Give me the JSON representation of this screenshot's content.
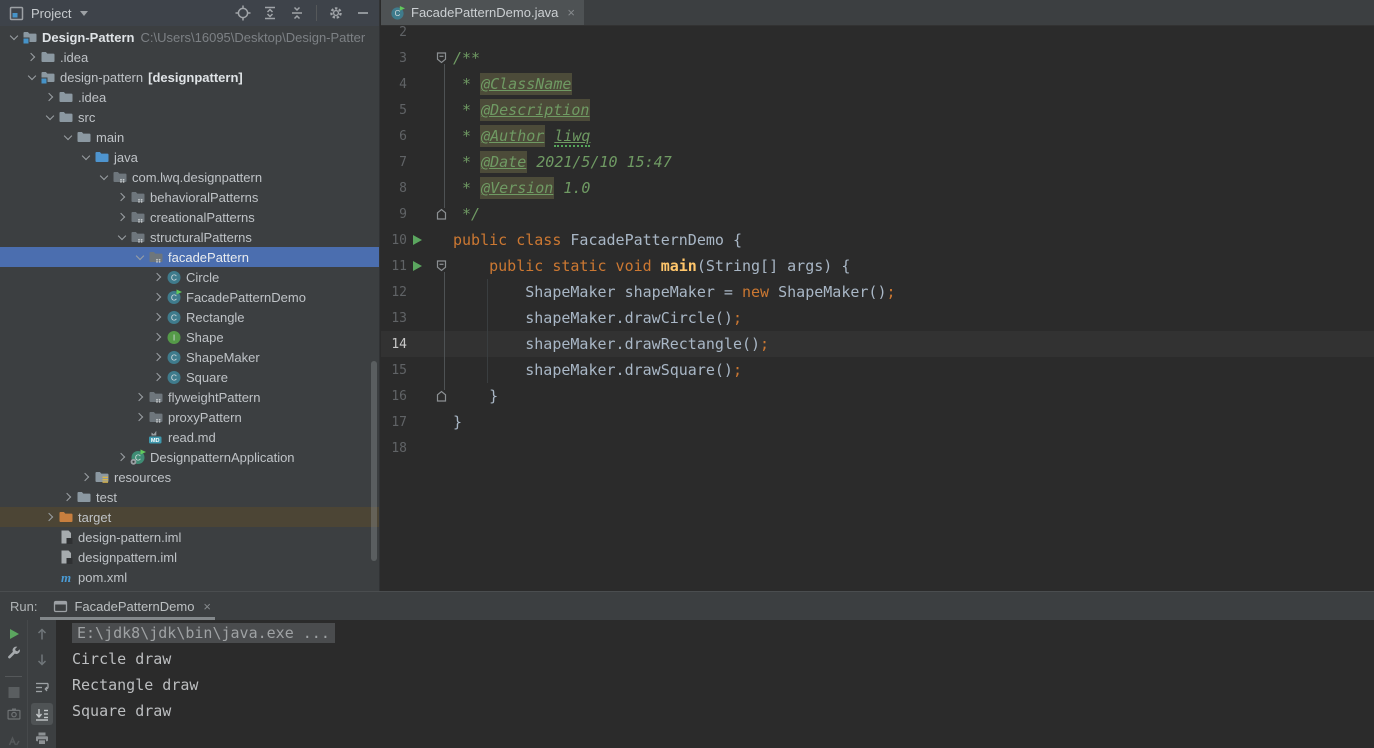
{
  "colors": {
    "selection_blue": "#4b6eaf",
    "excluded_row_bg": "#4c4535",
    "panel_bg": "#3c3f41",
    "editor_bg": "#2b2b2b",
    "current_line_bg": "#323232",
    "keyword_orange": "#cc7832",
    "plain_text": "#a9b7c6",
    "method_yellow": "#ffc66b",
    "comment_green": "#6f9a63",
    "doc_tag_bg": "#4c4b39",
    "run_green": "#5ba65f"
  },
  "project_panel": {
    "title": "Project",
    "header_icons": [
      "project-window-icon",
      "locate-icon",
      "expand-all-icon",
      "collapse-all-icon",
      "settings-gear-icon",
      "hide-panel-icon"
    ],
    "tree": [
      {
        "label": "Design-Pattern",
        "bold": true,
        "suffix": "C:\\Users\\16095\\Desktop\\Design-Patter",
        "level": 0,
        "chevron": "expanded",
        "icon": "module-folder"
      },
      {
        "label": ".idea",
        "level": 1,
        "chevron": "collapsed",
        "icon": "folder"
      },
      {
        "label": "design-pattern",
        "suffix_bold": "[designpattern]",
        "level": 1,
        "chevron": "expanded",
        "icon": "module-folder"
      },
      {
        "label": ".idea",
        "level": 2,
        "chevron": "collapsed",
        "icon": "folder"
      },
      {
        "label": "src",
        "level": 2,
        "chevron": "expanded",
        "icon": "folder"
      },
      {
        "label": "main",
        "level": 3,
        "chevron": "expanded",
        "icon": "folder"
      },
      {
        "label": "java",
        "level": 4,
        "chevron": "expanded",
        "icon": "source-folder"
      },
      {
        "label": "com.lwq.designpattern",
        "level": 5,
        "chevron": "expanded",
        "icon": "package"
      },
      {
        "label": "behavioralPatterns",
        "level": 6,
        "chevron": "collapsed",
        "icon": "package"
      },
      {
        "label": "creationalPatterns",
        "level": 6,
        "chevron": "collapsed",
        "icon": "package"
      },
      {
        "label": "structuralPatterns",
        "level": 6,
        "chevron": "expanded",
        "icon": "package"
      },
      {
        "label": "facadePattern",
        "level": 7,
        "chevron": "expanded",
        "icon": "package",
        "state": "selected"
      },
      {
        "label": "Circle",
        "level": 8,
        "chevron": "collapsed",
        "icon": "class"
      },
      {
        "label": "FacadePatternDemo",
        "level": 8,
        "chevron": "collapsed",
        "icon": "class-run"
      },
      {
        "label": "Rectangle",
        "level": 8,
        "chevron": "collapsed",
        "icon": "class"
      },
      {
        "label": "Shape",
        "level": 8,
        "chevron": "collapsed",
        "icon": "interface"
      },
      {
        "label": "ShapeMaker",
        "level": 8,
        "chevron": "collapsed",
        "icon": "class"
      },
      {
        "label": "Square",
        "level": 8,
        "chevron": "collapsed",
        "icon": "class"
      },
      {
        "label": "flyweightPattern",
        "level": 7,
        "chevron": "collapsed",
        "icon": "package"
      },
      {
        "label": "proxyPattern",
        "level": 7,
        "chevron": "collapsed",
        "icon": "package"
      },
      {
        "label": "read.md",
        "level": 7,
        "chevron": "none",
        "icon": "markdown"
      },
      {
        "label": "DesignpatternApplication",
        "level": 6,
        "chevron": "collapsed",
        "icon": "class-run-config"
      },
      {
        "label": "resources",
        "level": 4,
        "chevron": "collapsed",
        "icon": "resources-folder"
      },
      {
        "label": "test",
        "level": 3,
        "chevron": "collapsed",
        "icon": "folder"
      },
      {
        "label": "target",
        "level": 2,
        "chevron": "collapsed",
        "icon": "excluded-folder",
        "state": "excluded"
      },
      {
        "label": "design-pattern.iml",
        "level": 2,
        "chevron": "none",
        "icon": "iml-file"
      },
      {
        "label": "designpattern.iml",
        "level": 2,
        "chevron": "none",
        "icon": "iml-file"
      },
      {
        "label": "pom.xml",
        "level": 2,
        "chevron": "none",
        "icon": "maven-file"
      }
    ]
  },
  "editor": {
    "tab": {
      "label": "FacadePatternDemo.java",
      "icon": "class-run",
      "close": "×"
    },
    "lines": [
      {
        "num": 2,
        "tokens": []
      },
      {
        "num": 3,
        "fold": "start",
        "tokens": [
          [
            "/**",
            "cm"
          ]
        ]
      },
      {
        "num": 4,
        "tokens": [
          [
            " * ",
            "cm"
          ],
          [
            "@ClassName",
            "tag"
          ]
        ]
      },
      {
        "num": 5,
        "tokens": [
          [
            " * ",
            "cm"
          ],
          [
            "@Description",
            "tag"
          ]
        ]
      },
      {
        "num": 6,
        "tokens": [
          [
            " * ",
            "cm"
          ],
          [
            "@Author",
            "tag"
          ],
          [
            " ",
            "cm"
          ],
          [
            "liwq",
            "typo"
          ]
        ]
      },
      {
        "num": 7,
        "tokens": [
          [
            " * ",
            "cm"
          ],
          [
            "@Date",
            "tag"
          ],
          [
            " 2021/5/10 15:47",
            "cm"
          ]
        ]
      },
      {
        "num": 8,
        "tokens": [
          [
            " * ",
            "cm"
          ],
          [
            "@Version",
            "tag"
          ],
          [
            " 1.0",
            "cm"
          ]
        ]
      },
      {
        "num": 9,
        "fold": "end",
        "tokens": [
          [
            " */",
            "cm"
          ]
        ]
      },
      {
        "num": 10,
        "run": true,
        "tokens": [
          [
            "public class ",
            "kw"
          ],
          [
            "FacadePatternDemo {",
            "pl"
          ]
        ]
      },
      {
        "num": 11,
        "run": true,
        "fold": "start",
        "tokens": [
          [
            "    ",
            "pl"
          ],
          [
            "public static void ",
            "kw"
          ],
          [
            "main",
            "mn"
          ],
          [
            "(String[] args) {",
            "pl"
          ]
        ]
      },
      {
        "num": 12,
        "tokens": [
          [
            "        ShapeMaker shapeMaker = ",
            "pl"
          ],
          [
            "new",
            "kw"
          ],
          [
            " ShapeMaker()",
            "pl"
          ],
          [
            ";",
            "kw"
          ]
        ]
      },
      {
        "num": 13,
        "tokens": [
          [
            "        shapeMaker.drawCircle()",
            "pl"
          ],
          [
            ";",
            "kw"
          ]
        ]
      },
      {
        "num": 14,
        "current": true,
        "tokens": [
          [
            "        shapeMaker.drawRectangle()",
            "pl"
          ],
          [
            ";",
            "kw"
          ]
        ]
      },
      {
        "num": 15,
        "tokens": [
          [
            "        shapeMaker.drawSquare()",
            "pl"
          ],
          [
            ";",
            "kw"
          ]
        ]
      },
      {
        "num": 16,
        "fold": "end",
        "tokens": [
          [
            "    }",
            "pl"
          ]
        ]
      },
      {
        "num": 17,
        "tokens": [
          [
            "}",
            "pl"
          ]
        ]
      },
      {
        "num": 18,
        "tokens": []
      }
    ]
  },
  "run_panel": {
    "label": "Run:",
    "tab": {
      "label": "FacadePatternDemo",
      "icon": "console",
      "close": "×"
    },
    "left_toolbar_icons": [
      "rerun-icon",
      "settings-wrench-icon",
      "stop-icon",
      "camera-icon",
      "build-icon"
    ],
    "inner_toolbar_icons": [
      "up-arrow-icon",
      "down-arrow-icon",
      "soft-wrap-icon",
      "scroll-to-end-icon",
      "print-icon"
    ],
    "console": [
      {
        "text": "E:\\jdk8\\jdk\\bin\\java.exe ...",
        "style": "command"
      },
      {
        "text": "Circle draw",
        "style": "output"
      },
      {
        "text": "Rectangle draw",
        "style": "output"
      },
      {
        "text": "Square draw",
        "style": "output"
      }
    ]
  }
}
